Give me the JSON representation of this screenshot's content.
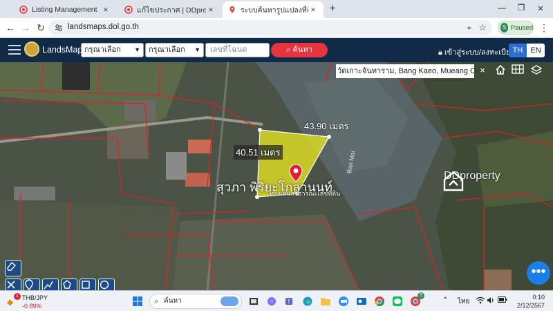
{
  "browser": {
    "tabs": [
      {
        "label": "Listing Management",
        "close": "×"
      },
      {
        "label": "แก้ไขประกาศ | DDproperty",
        "close": "×"
      },
      {
        "label": "ระบบค้นหารูปแปลงที่ดิน (LandsMap)",
        "close": "×"
      }
    ],
    "new_tab": "+",
    "window": {
      "minimize": "—",
      "maximize": "❐",
      "close": "×"
    },
    "url": "landsmaps.dol.go.th",
    "profile_badge": "S",
    "profile_status": "Paused"
  },
  "site": {
    "brand": "LandsMaps",
    "province_placeholder": "กรุณาเลือกจังหวัด",
    "district_placeholder": "กรุณาเลือกอำเภอ",
    "parcel_placeholder": "เลขที่โฉนด",
    "search_label": "ค้นหา",
    "login_label": "เข้าสู่ระบบ/ลงทะเบียน",
    "lang_th": "TH",
    "lang_en": "EN"
  },
  "map": {
    "location_text": "วัดเกาะจันทาราม, Bang Kaeo, Mueang Chachoengsao",
    "close": "×",
    "dist_top": "43.90 เมตร",
    "dist_left": "40.51 เมตร",
    "owner_name": "สุวภา พิริยะโกลานนท์",
    "owner_sub": "ทางเดินสาธารณะเลขที่ดิน",
    "road_label": "Ban Mai",
    "watermark": "DDproperty",
    "fab": "•••"
  },
  "taskbar": {
    "badge": "1",
    "stock_pair": "THB/JPY",
    "stock_change": "-0.89%",
    "search_placeholder": "ค้นหา",
    "tray_lang": "ไทย",
    "time": "0:10",
    "date": "2/12/2567",
    "chrome_badge": "S"
  },
  "colors": {
    "header_bg": "#102a48",
    "search_btn": "#e8343f",
    "parcel_fill": "#e6e621",
    "boundary": "#e02020",
    "lang_active": "#2b6fd6"
  }
}
